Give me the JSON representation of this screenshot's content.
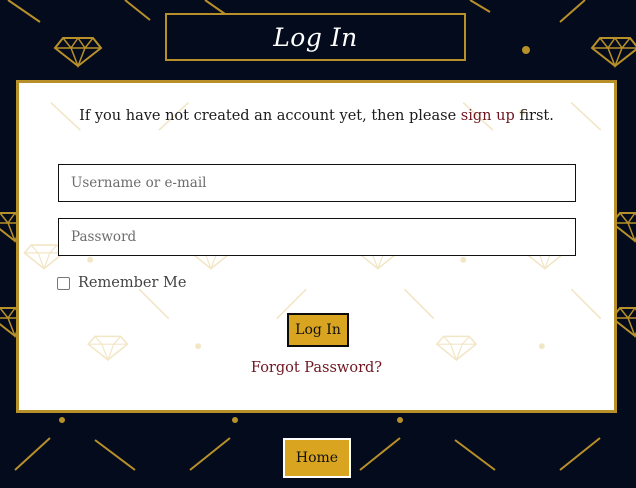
{
  "page": {
    "title": "Log In"
  },
  "form": {
    "intro_before": "If you have not created an account yet, then please ",
    "signup_link": "sign up",
    "intro_after": " first.",
    "username_placeholder": "Username or e-mail",
    "password_placeholder": "Password",
    "remember_label": "Remember Me",
    "remember_checked": false,
    "login_button": "Log In",
    "forgot_link": "Forgot Password?"
  },
  "footer": {
    "home_button": "Home"
  },
  "colors": {
    "background": "#030b1c",
    "accent_gold": "#b8902a",
    "button_gold": "#d9a520",
    "link_maroon": "#6d1620"
  },
  "icons": {
    "pattern": "diamond-icon"
  }
}
